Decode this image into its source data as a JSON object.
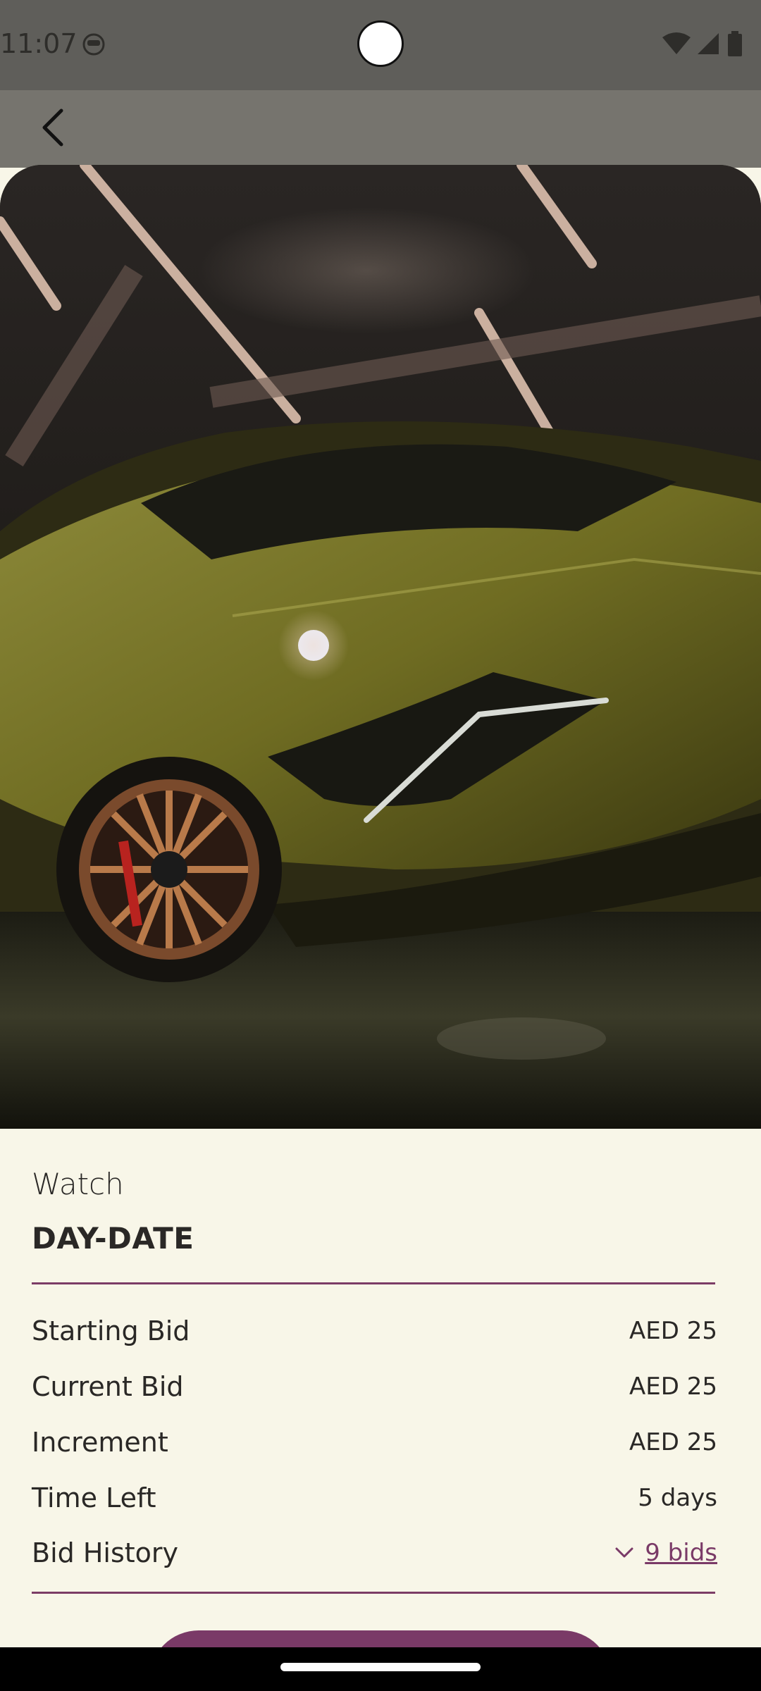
{
  "status_bar": {
    "time": "11:07",
    "icons": [
      "notification-icon",
      "wifi-icon",
      "cellular-icon",
      "battery-icon"
    ]
  },
  "app_bar": {
    "back_icon": "chevron-left-icon"
  },
  "hero": {
    "image_subject": "olive green sports car in a dark garage"
  },
  "item": {
    "category": "Watch",
    "name": "DAY-DATE"
  },
  "details": [
    {
      "label": "Starting Bid",
      "value": "AED 25"
    },
    {
      "label": "Current Bid",
      "value": "AED 25"
    },
    {
      "label": "Increment",
      "value": "AED 25"
    },
    {
      "label": "Time Left",
      "value": "5 days"
    }
  ],
  "bid_history": {
    "label": "Bid History",
    "link": "9 bids"
  },
  "colors": {
    "accent": "#7a3a67",
    "panel_background": "#f8f6e8",
    "app_bar": "#76746e",
    "status_bar": "#5f5e5a"
  }
}
